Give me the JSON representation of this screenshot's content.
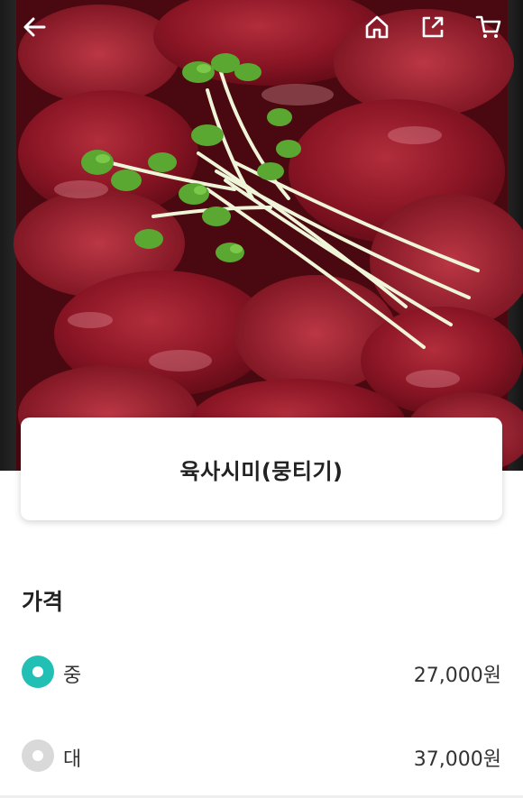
{
  "header": {
    "back_icon": "arrow-left-icon",
    "home_icon": "home-icon",
    "share_icon": "share-icon",
    "cart_icon": "cart-icon"
  },
  "product": {
    "name": "육사시미(뭉티기)",
    "image_description": "photo"
  },
  "price_section": {
    "title": "가격",
    "options": [
      {
        "label": "중",
        "price": "27,000원",
        "selected": true
      },
      {
        "label": "대",
        "price": "37,000원",
        "selected": false
      }
    ]
  },
  "colors": {
    "accent": "#22bfb5",
    "radio_off": "#d9d9d9",
    "meat_dark": "#6e0f1a",
    "meat_mid": "#9a1a2a",
    "meat_light": "#b8303f",
    "sprout_green": "#5aa832",
    "sprout_stem": "#e8f2d2"
  }
}
